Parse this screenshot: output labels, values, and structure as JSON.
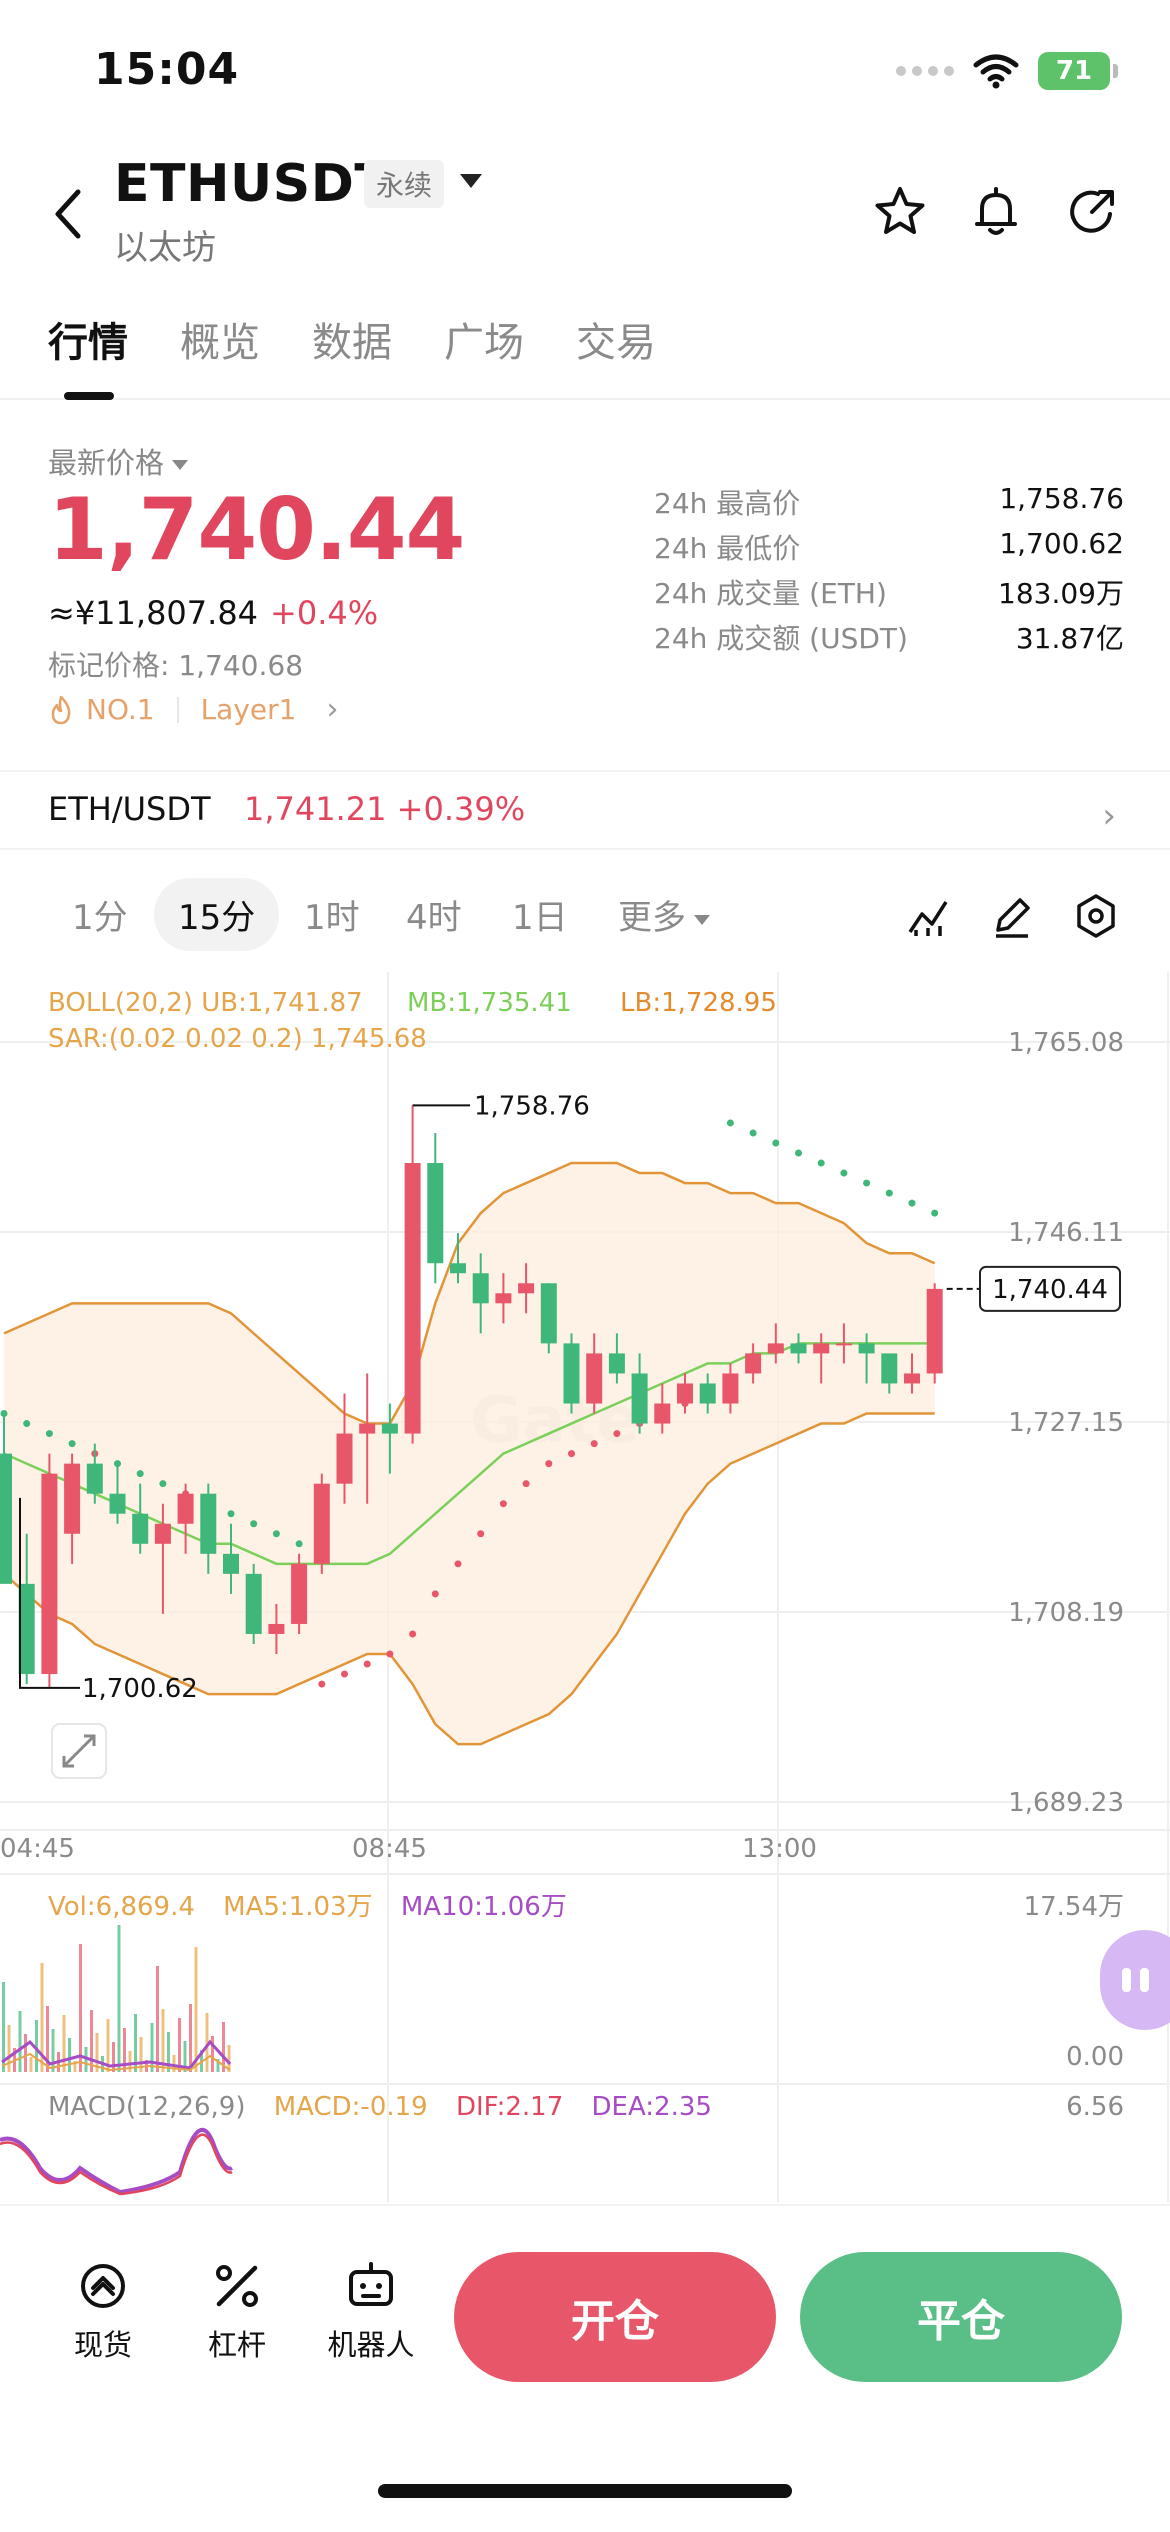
{
  "status": {
    "time": "15:04",
    "battery": "71"
  },
  "header": {
    "symbol": "ETHUSDT",
    "contract_tag": "永续",
    "name": "以太坊"
  },
  "tabs": [
    {
      "label": "行情",
      "active": true
    },
    {
      "label": "概览"
    },
    {
      "label": "数据"
    },
    {
      "label": "广场"
    },
    {
      "label": "交易"
    }
  ],
  "price": {
    "label": "最新价格",
    "last": "1,740.44",
    "cny": "≈¥11,807.84",
    "change": "+0.4%",
    "mark": "标记价格: 1,740.68",
    "rank": "NO.1",
    "tag": "Layer1"
  },
  "stats": [
    {
      "key": "24h 最高价",
      "value": "1,758.76"
    },
    {
      "key": "24h 最低价",
      "value": "1,700.62"
    },
    {
      "key": "24h 成交量 (ETH)",
      "value": "183.09万"
    },
    {
      "key": "24h 成交额 (USDT)",
      "value": "31.87亿"
    }
  ],
  "pair": {
    "name": "ETH/USDT",
    "price": "1,741.21",
    "change": "+0.39%"
  },
  "timeframes": {
    "items": [
      "1分",
      "15分",
      "1时",
      "4时",
      "1日"
    ],
    "active": "15分",
    "more": "更多"
  },
  "indicators": {
    "boll": "BOLL(20,2)",
    "ub": "UB:1,741.87",
    "mb": "MB:1,735.41",
    "lb": "LB:1,728.95",
    "sar": "SAR:(0.02 0.02 0.2) 1,745.68",
    "vol": "Vol:6,869.4",
    "ma5": "MA5:1.03万",
    "ma10": "MA10:1.06万",
    "macd_title": "MACD(12,26,9)",
    "macd": "MACD:-0.19",
    "dif": "DIF:2.17",
    "dea": "DEA:2.35"
  },
  "chart": {
    "y_labels": [
      "1,765.08",
      "1,746.11",
      "1,727.15",
      "1,708.19",
      "1,689.23"
    ],
    "x_labels": [
      "04:45",
      "08:45",
      "13:00"
    ],
    "high_label": "1,758.76",
    "low_label": "1,700.62",
    "current_label": "1,740.44",
    "vol_max": "17.54万",
    "vol_min": "0.00",
    "macd_max": "6.56",
    "watermark": "Gate"
  },
  "chart_data": {
    "type": "candlestick",
    "interval": "15分",
    "ylim": [
      1689.23,
      1765.08
    ],
    "y_ticks": [
      1765.08,
      1746.11,
      1727.15,
      1708.19,
      1689.23
    ],
    "x_ticks": [
      "04:45",
      "08:45",
      "13:00"
    ],
    "up_color": "#e8566a",
    "down_color": "#3fb77a",
    "candles": [
      [
        1724,
        1728,
        1712,
        1711
      ],
      [
        1711,
        1716,
        1701,
        1702
      ],
      [
        1702,
        1724,
        1700.62,
        1722
      ],
      [
        1716,
        1724,
        1713,
        1723
      ],
      [
        1723,
        1725,
        1719,
        1720
      ],
      [
        1720,
        1723,
        1717,
        1718
      ],
      [
        1718,
        1721,
        1714,
        1715
      ],
      [
        1715,
        1719,
        1708,
        1717
      ],
      [
        1717,
        1721,
        1714,
        1720
      ],
      [
        1720,
        1721,
        1712,
        1714
      ],
      [
        1714,
        1717,
        1710,
        1712
      ],
      [
        1712,
        1713,
        1705,
        1706
      ],
      [
        1706,
        1709,
        1704,
        1707
      ],
      [
        1707,
        1714,
        1706,
        1713
      ],
      [
        1713,
        1722,
        1712,
        1721
      ],
      [
        1721,
        1730,
        1719,
        1726
      ],
      [
        1726,
        1732,
        1719,
        1727
      ],
      [
        1727,
        1729,
        1722,
        1726
      ],
      [
        1726,
        1758.76,
        1725,
        1753
      ],
      [
        1753,
        1756,
        1741,
        1743
      ],
      [
        1743,
        1746,
        1741,
        1742
      ],
      [
        1742,
        1744,
        1736,
        1739
      ],
      [
        1739,
        1742,
        1737,
        1740
      ],
      [
        1740,
        1743,
        1738,
        1741
      ],
      [
        1741,
        1741,
        1734,
        1735
      ],
      [
        1735,
        1736,
        1728,
        1729
      ],
      [
        1729,
        1736,
        1728,
        1734
      ],
      [
        1734,
        1736,
        1731,
        1732
      ],
      [
        1732,
        1734,
        1726,
        1727
      ],
      [
        1727,
        1731,
        1726,
        1729
      ],
      [
        1729,
        1732,
        1728,
        1731
      ],
      [
        1731,
        1732,
        1728,
        1729
      ],
      [
        1729,
        1733,
        1728,
        1732
      ],
      [
        1732,
        1735,
        1731,
        1734
      ],
      [
        1734,
        1737,
        1733,
        1735
      ],
      [
        1735,
        1736,
        1733,
        1734
      ],
      [
        1734,
        1736,
        1731,
        1735
      ],
      [
        1735,
        1737,
        1733,
        1735
      ],
      [
        1735,
        1736,
        1731,
        1734
      ],
      [
        1734,
        1734,
        1730,
        1731
      ],
      [
        1731,
        1734,
        1730,
        1732
      ],
      [
        1732,
        1741,
        1731,
        1740.44
      ]
    ],
    "boll_ub": [
      1736,
      1737,
      1738,
      1739,
      1739,
      1739,
      1739,
      1739,
      1739,
      1739,
      1738,
      1736,
      1734,
      1732,
      1730,
      1728,
      1727,
      1727,
      1731,
      1739,
      1745,
      1748,
      1750,
      1751,
      1752,
      1753,
      1753,
      1753,
      1752,
      1752,
      1751,
      1751,
      1750,
      1750,
      1749,
      1749,
      1748,
      1747,
      1745,
      1744,
      1744,
      1743
    ],
    "boll_mb": [
      1724,
      1723,
      1722,
      1721,
      1720,
      1719,
      1718,
      1717,
      1716,
      1715,
      1715,
      1714,
      1713,
      1713,
      1713,
      1713,
      1713,
      1714,
      1716,
      1718,
      1720,
      1722,
      1724,
      1725,
      1726,
      1727,
      1728,
      1729,
      1730,
      1731,
      1732,
      1733,
      1733,
      1734,
      1734,
      1735,
      1735,
      1735,
      1735,
      1735,
      1735,
      1735
    ],
    "boll_lb": [
      1712,
      1710,
      1708,
      1707,
      1705,
      1704,
      1703,
      1702,
      1701,
      1700,
      1700,
      1700,
      1700,
      1701,
      1702,
      1703,
      1704,
      1704,
      1701,
      1697,
      1695,
      1695,
      1696,
      1697,
      1698,
      1700,
      1703,
      1706,
      1710,
      1714,
      1718,
      1721,
      1723,
      1724,
      1725,
      1726,
      1727,
      1727,
      1728,
      1728,
      1728,
      1728
    ],
    "sar": [
      [
        0,
        1728
      ],
      [
        1,
        1727
      ],
      [
        2,
        1726
      ],
      [
        3,
        1725
      ],
      [
        4,
        1724
      ],
      [
        5,
        1723
      ],
      [
        6,
        1722
      ],
      [
        7,
        1721
      ],
      [
        8,
        1720
      ],
      [
        9,
        1719
      ],
      [
        10,
        1718
      ],
      [
        11,
        1717
      ],
      [
        12,
        1716
      ],
      [
        13,
        1715
      ],
      [
        14,
        1701
      ],
      [
        15,
        1702
      ],
      [
        16,
        1703
      ],
      [
        17,
        1704
      ],
      [
        18,
        1706
      ],
      [
        19,
        1710
      ],
      [
        20,
        1713
      ],
      [
        21,
        1716
      ],
      [
        22,
        1719
      ],
      [
        23,
        1721
      ],
      [
        24,
        1723
      ],
      [
        25,
        1724
      ],
      [
        26,
        1725
      ],
      [
        27,
        1726
      ],
      [
        28,
        1727
      ],
      [
        29,
        1728
      ],
      [
        30,
        1729
      ],
      [
        31,
        1730
      ],
      [
        32,
        1757
      ],
      [
        33,
        1756
      ],
      [
        34,
        1755
      ],
      [
        35,
        1754
      ],
      [
        36,
        1753
      ],
      [
        37,
        1752
      ],
      [
        38,
        1751
      ],
      [
        39,
        1750
      ],
      [
        40,
        1749
      ],
      [
        41,
        1748
      ]
    ]
  },
  "actions": {
    "spot": "现货",
    "leverage": "杠杆",
    "bot": "机器人",
    "open": "开仓",
    "close": "平仓"
  }
}
